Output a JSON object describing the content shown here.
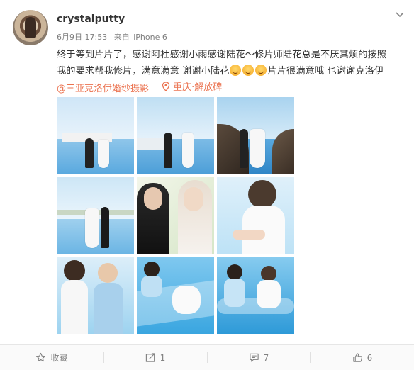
{
  "post": {
    "username": "crystalputty",
    "date": "6月9日 17:53",
    "source_prefix": "来自",
    "source": "iPhone 6",
    "text_lines": [
      "终于等到片片了，感谢阿杜感谢小雨感谢陆花～修片师陆花总是不厌其烦的按照",
      "我的要求帮我修片，满意满意  谢谢小陆花",
      "片片很满意哦  也谢谢克洛伊"
    ],
    "emoji_names": [
      "smile-emoji",
      "smile-emoji",
      "smile-emoji"
    ],
    "mention": "@三亚克洛伊婚纱摄影",
    "location": "重庆·解放碑",
    "photo_count": 9
  },
  "actions": {
    "favorite_label": "收藏",
    "repost_count": "1",
    "comment_count": "7",
    "like_count": "6"
  },
  "colors": {
    "link": "#eb7350",
    "meta": "#808080",
    "text": "#333333",
    "sea_blue": "#3aa6e0"
  }
}
